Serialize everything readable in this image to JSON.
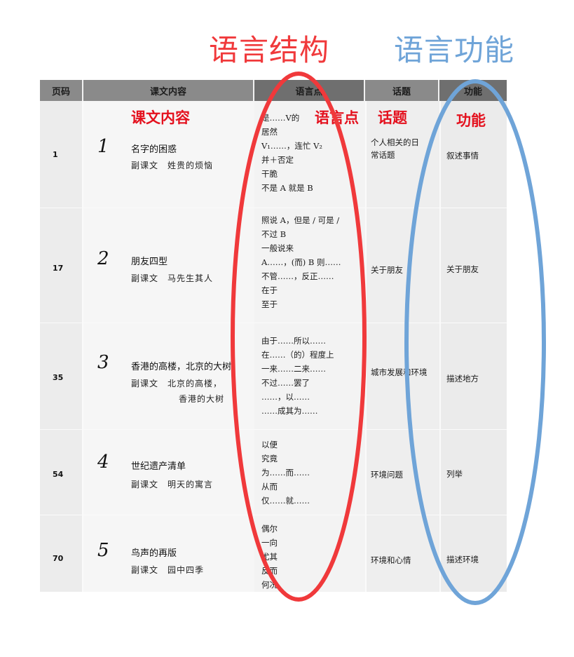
{
  "labels": {
    "structure": "语言结构",
    "function": "语言功能"
  },
  "table": {
    "headers": {
      "page": "页码",
      "content": "课文内容",
      "points": "语言点",
      "topic": "话题",
      "function": "功能"
    },
    "subheaders": {
      "content": "课文内容",
      "points": "语言点",
      "topic": "话题",
      "function": "功能"
    },
    "rows": [
      {
        "page": "1",
        "no": "1",
        "title": "名字的困惑",
        "sub": "副课文　姓贵的烦恼",
        "sub2": "",
        "points": [
          "是……V的",
          "居然",
          "V₁……，连忙 V₂",
          "并＋否定",
          "干脆",
          "不是 A 就是 B"
        ],
        "topic": "个人相关的日常话题",
        "function": "叙述事情"
      },
      {
        "page": "17",
        "no": "2",
        "title": "朋友四型",
        "sub": "副课文　马先生其人",
        "sub2": "",
        "points": [
          "照说 A，但是 / 可是 /",
          "不过 B",
          "一般说来",
          "A……，(而) B 则……",
          "不管……，反正……",
          "在于",
          "至于"
        ],
        "topic": "关于朋友",
        "function": "关于朋友"
      },
      {
        "page": "35",
        "no": "3",
        "title": "香港的高楼，北京的大树",
        "sub": "副课文　北京的高楼，",
        "sub2": "香港的大树",
        "points": [
          "由于……所以……",
          "在……（的）程度上",
          "一来……二来……",
          "不过……罢了",
          "……，以……",
          "……成其为……"
        ],
        "topic": "城市发展和环境",
        "function": "描述地方"
      },
      {
        "page": "54",
        "no": "4",
        "title": "世纪遗产清单",
        "sub": "副课文　明天的寓言",
        "sub2": "",
        "points": [
          "以便",
          "究竟",
          "为……而……",
          "从而",
          "仅……就……"
        ],
        "topic": "环境问题",
        "function": "列举"
      },
      {
        "page": "70",
        "no": "5",
        "title": "鸟声的再版",
        "sub": "副课文　园中四季",
        "sub2": "",
        "points": [
          "偶尔",
          "一向",
          "尤其",
          "反而",
          "何况"
        ],
        "topic": "环境和心情",
        "function": "描述环境"
      }
    ]
  },
  "colors": {
    "structure_oval": "#f0393b",
    "function_oval": "#6fa4d8",
    "header_bg": "#8a8a8a",
    "subheader_red": "#e4111e"
  }
}
